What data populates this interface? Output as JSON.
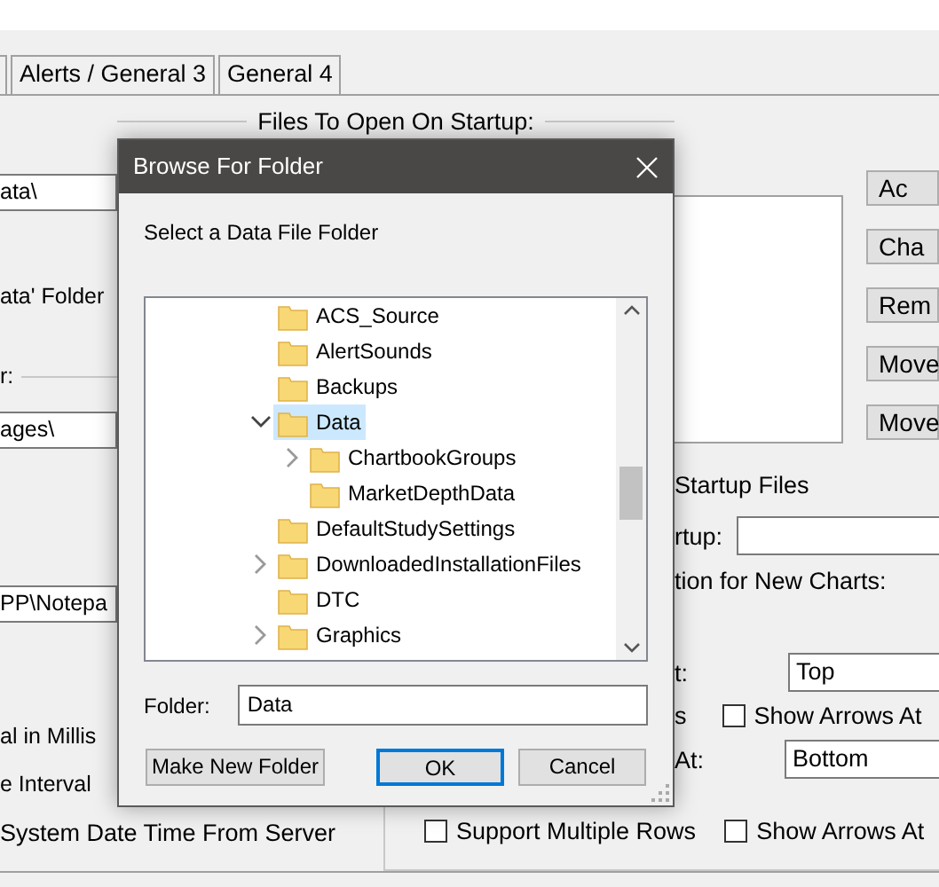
{
  "tabs": [
    {
      "label": "Alerts / General 3"
    },
    {
      "label": "General 4"
    }
  ],
  "startup_group": {
    "title": "Files To Open On Startup:"
  },
  "left_panel": [
    {
      "kind": "field",
      "value": "ata\\"
    },
    {
      "kind": "label",
      "text": "ata' Folder"
    },
    {
      "kind": "group",
      "text": "r:"
    },
    {
      "kind": "field",
      "value": "ages\\"
    },
    {
      "kind": "field",
      "value": "PP\\Notepa"
    },
    {
      "kind": "label",
      "text": "al in Millis"
    },
    {
      "kind": "label",
      "text": "e Interval"
    }
  ],
  "file_buttons": [
    "Ac",
    "Cha",
    "Rem",
    "Move",
    "Move"
  ],
  "right_panel": [
    {
      "kind": "label",
      "text": "Startup Files"
    },
    {
      "kind": "field",
      "label": "rtup:"
    },
    {
      "kind": "label",
      "text": "tion for New Charts:"
    },
    {
      "kind": "select",
      "label": "t:",
      "value": "Top"
    },
    {
      "kind": "checkbox",
      "label": "s",
      "text": "Show Arrows At",
      "checked": false
    },
    {
      "kind": "select",
      "label": "At:",
      "value": "Bottom"
    }
  ],
  "bottom_row": {
    "text": "System Date Time From Server",
    "checkboxes": [
      {
        "text": "Support Multiple Rows",
        "checked": false
      },
      {
        "text": "Show Arrows At",
        "checked": false
      }
    ]
  },
  "dialog": {
    "title": "Browse For Folder",
    "prompt": "Select a Data File Folder",
    "tree": [
      {
        "label": "ACS_Source",
        "expandable": false,
        "selected": false
      },
      {
        "label": "AlertSounds",
        "expandable": false,
        "selected": false
      },
      {
        "label": "Backups",
        "expandable": false,
        "selected": false
      },
      {
        "label": "Data",
        "expandable": true,
        "expanded": true,
        "selected": true,
        "children": [
          {
            "label": "ChartbookGroups",
            "expandable": true,
            "expanded": false,
            "selected": false
          },
          {
            "label": "MarketDepthData",
            "expandable": false,
            "selected": false
          }
        ]
      },
      {
        "label": "DefaultStudySettings",
        "expandable": false,
        "selected": false
      },
      {
        "label": "DownloadedInstallationFiles",
        "expandable": true,
        "expanded": false,
        "selected": false
      },
      {
        "label": "DTC",
        "expandable": false,
        "selected": false
      },
      {
        "label": "Graphics",
        "expandable": true,
        "expanded": false,
        "selected": false
      }
    ],
    "folder_label": "Folder:",
    "folder_value": "Data",
    "buttons": [
      {
        "label": "Make New Folder",
        "default": false
      },
      {
        "label": "OK",
        "default": true
      },
      {
        "label": "Cancel",
        "default": false
      }
    ]
  }
}
